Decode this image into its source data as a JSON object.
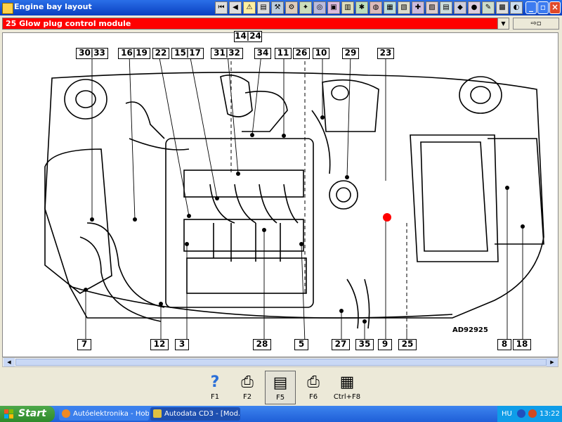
{
  "window": {
    "title": "Engine bay layout"
  },
  "toolbar": {
    "icons": [
      "first-page-icon",
      "previous-page-icon",
      "warning-icon",
      "book-icon",
      "wrench-icon",
      "engine-icon",
      "gear-icon",
      "tyre-icon",
      "car-icon",
      "battery-icon",
      "light-icon",
      "belt-icon",
      "car-front-icon",
      "filter-icon",
      "spanner-icon",
      "cabin-icon",
      "document-icon",
      "coolant-icon",
      "airbag-icon",
      "service-icon",
      "parts-icon",
      "timing-icon"
    ]
  },
  "selector": {
    "value": "25  Glow plug control module",
    "aux_label": "⇨▫"
  },
  "diagram": {
    "code": "AD92925",
    "labels_top": [
      "14",
      "24",
      "30",
      "33",
      "16",
      "19",
      "22",
      "15",
      "17",
      "31",
      "32",
      "34",
      "11",
      "26",
      "10",
      "29",
      "23"
    ],
    "labels_bottom": [
      "7",
      "12",
      "3",
      "28",
      "5",
      "27",
      "35",
      "9",
      "25",
      "8",
      "18"
    ]
  },
  "fkeys": [
    {
      "label": "F1",
      "icon": "help-icon"
    },
    {
      "label": "F2",
      "icon": "print-setup-icon"
    },
    {
      "label": "F5",
      "icon": "document-icon"
    },
    {
      "label": "F6",
      "icon": "printer-icon"
    },
    {
      "label": "Ctrl+F8",
      "icon": "table-icon"
    }
  ],
  "taskbar": {
    "start": "Start",
    "tasks": [
      "Autóelektronika - Hob...",
      "Autodata CD3 - [Mod..."
    ],
    "language": "HU",
    "clock": "13:22"
  },
  "colors": {
    "accent": "#ff0000",
    "marker": "#ff0000",
    "titlebar": "#0a3fc0"
  }
}
